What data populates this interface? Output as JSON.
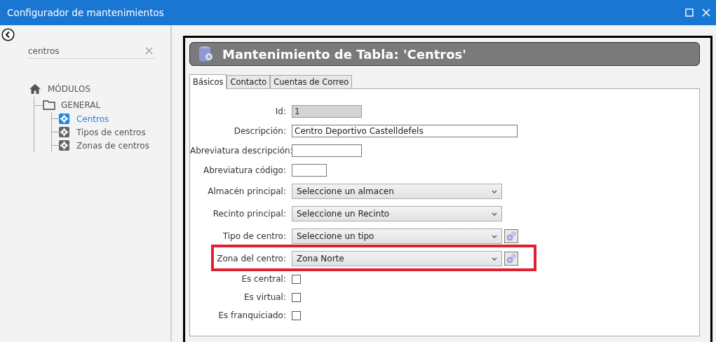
{
  "window": {
    "title": "Configurador de mantenimientos"
  },
  "sidebar": {
    "search": {
      "value": "centros"
    },
    "tree": {
      "label": "MÓDULOS",
      "children": [
        {
          "label": "GENERAL",
          "children": [
            {
              "label": "Centros",
              "selected": true
            },
            {
              "label": "Tipos de centros",
              "selected": false
            },
            {
              "label": "Zonas de centros",
              "selected": false
            }
          ]
        }
      ]
    }
  },
  "header": {
    "title": "Mantenimiento de Tabla: 'Centros'"
  },
  "tabs": [
    {
      "label": "Básicos",
      "selected": true
    },
    {
      "label": "Contacto",
      "selected": false
    },
    {
      "label": "Cuentas de Correo",
      "selected": false
    }
  ],
  "fields": [
    {
      "kind": "text",
      "label": "Id:",
      "value": "1",
      "disabled": true
    },
    {
      "kind": "text",
      "label": "Descripción:",
      "value": "Centro Deportivo Castelldefels",
      "disabled": false
    },
    {
      "kind": "text",
      "label": "Abreviatura descripción:",
      "disabled": false
    },
    {
      "kind": "text",
      "label": "Abreviatura código:",
      "disabled": false
    },
    {
      "kind": "select",
      "label": "Almacén principal:",
      "value": "Seleccione un almacen",
      "settings_button": false,
      "highlighted": false
    },
    {
      "kind": "select",
      "label": "Recinto principal:",
      "value": "Seleccione un Recinto",
      "settings_button": false,
      "highlighted": false
    },
    {
      "kind": "select",
      "label": "Tipo de centro:",
      "value": "Seleccione un tipo",
      "settings_button": true,
      "highlighted": false
    },
    {
      "kind": "select",
      "label": "Zona del centro:",
      "value": "Zona Norte",
      "settings_button": true,
      "highlighted": true
    },
    {
      "kind": "checkbox",
      "label": "Es central:",
      "checked": false
    },
    {
      "kind": "checkbox",
      "label": "Es virtual:",
      "checked": false
    },
    {
      "kind": "checkbox",
      "label": "Es franquiciado:",
      "checked": false
    }
  ]
}
